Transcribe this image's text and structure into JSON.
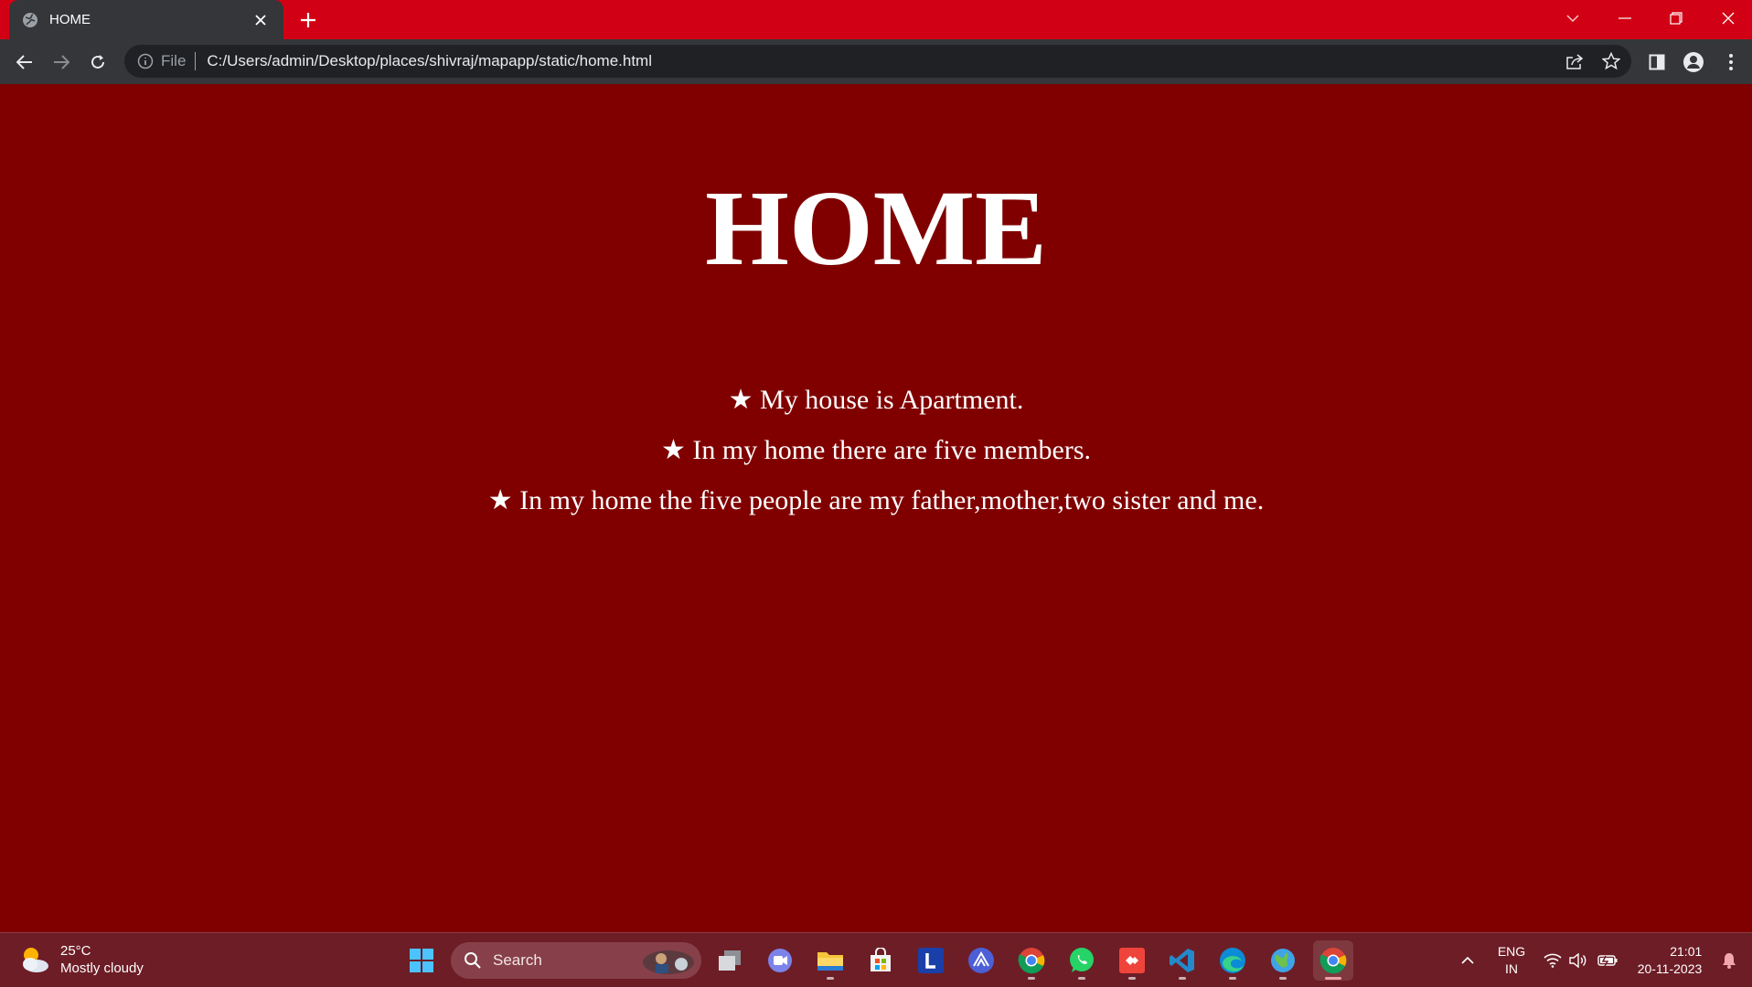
{
  "browser": {
    "tab_title": "HOME",
    "address_scheme": "File",
    "address_url": "C:/Users/admin/Desktop/places/shivraj/mapapp/static/home.html"
  },
  "page": {
    "heading": "HOME",
    "items": [
      "★ My house is Apartment.",
      "★ In my home there are five members.",
      "★ In my home the five people are my father,mother,two sister and me."
    ]
  },
  "taskbar": {
    "weather_temp": "25°C",
    "weather_desc": "Mostly cloudy",
    "search_placeholder": "Search",
    "lang_primary": "ENG",
    "lang_secondary": "IN",
    "time": "21:01",
    "date": "20-11-2023"
  },
  "colors": {
    "tabstrip": "#d10014",
    "page_background": "#800000",
    "taskbar": "#6d1d26"
  }
}
